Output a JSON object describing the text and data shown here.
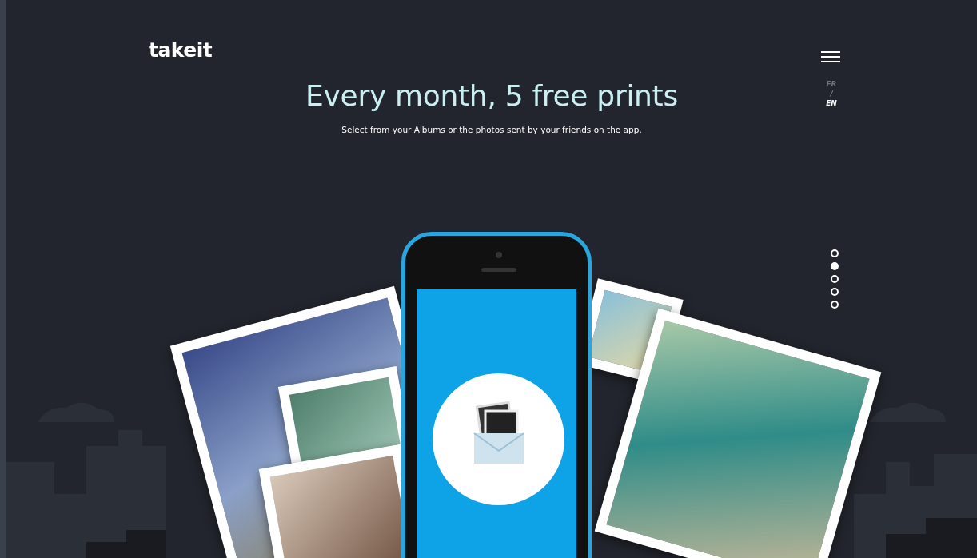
{
  "header": {
    "logo": "takeit",
    "languages": [
      {
        "label": "FR",
        "selected": false
      },
      {
        "label": "EN",
        "selected": true
      }
    ],
    "language_separator": "/"
  },
  "hero": {
    "title": "Every month, 5 free prints",
    "subtitle": "Select from your Albums or the photos sent by your friends on the app."
  },
  "pager": [
    {
      "selected": false
    },
    {
      "selected": true
    },
    {
      "selected": false
    },
    {
      "selected": false
    },
    {
      "selected": false
    }
  ]
}
